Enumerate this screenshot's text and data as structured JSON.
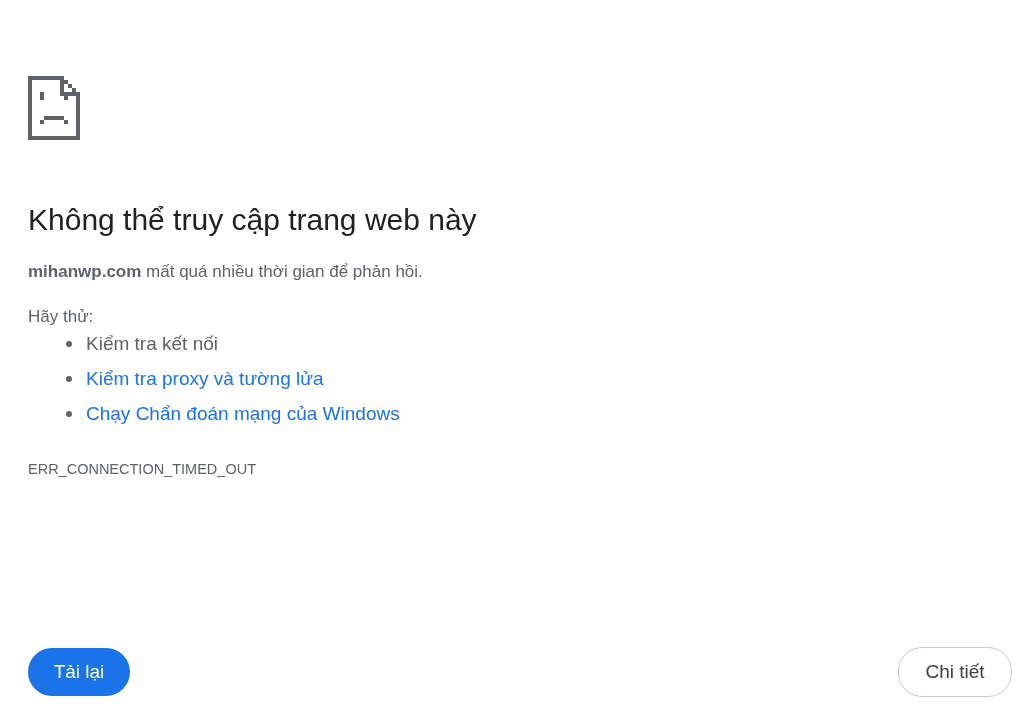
{
  "title": "Không thể truy cập trang web này",
  "message": "**mihanwp.com** mất quá nhiều thời gian để phản hồi.",
  "suggestions_heading": "Hãy thử:",
  "suggestions": [
    {
      "kind": "text",
      "label": "Kiểm tra kết nối"
    },
    {
      "kind": "link",
      "label": "Kiểm tra proxy và tường lửa"
    },
    {
      "kind": "link",
      "label": "Chạy Chẩn đoán mạng của Windows"
    }
  ],
  "error_code": "ERR_CONNECTION_TIMED_OUT",
  "buttons": [
    {
      "kind": "primary",
      "label": "Tải lại"
    },
    {
      "kind": "secondary",
      "label": "Chi tiết"
    }
  ]
}
